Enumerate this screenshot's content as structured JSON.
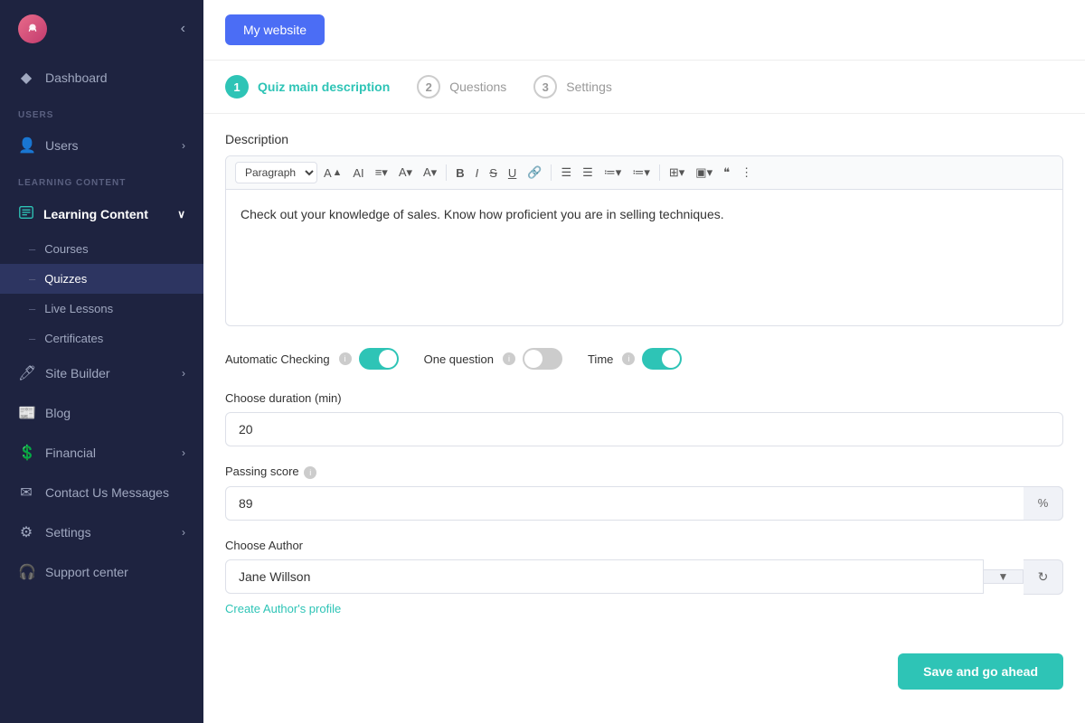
{
  "sidebar": {
    "logo": "🌸",
    "collapse_btn": "‹",
    "dashboard": {
      "label": "Dashboard",
      "icon": "◆"
    },
    "sections": {
      "users": {
        "label": "USERS",
        "items": [
          {
            "id": "users",
            "label": "Users",
            "icon": "👤",
            "arrow": "›"
          }
        ]
      },
      "learning_content": {
        "label": "LEARNING CONTENT",
        "main_label": "Learning Content",
        "icon": "📋",
        "arrow": "∨",
        "sub_items": [
          {
            "id": "courses",
            "label": "Courses"
          },
          {
            "id": "quizzes",
            "label": "Quizzes",
            "active": true
          },
          {
            "id": "live-lessons",
            "label": "Live Lessons"
          },
          {
            "id": "certificates",
            "label": "Certificates"
          }
        ]
      }
    },
    "bottom_items": [
      {
        "id": "site-builder",
        "label": "Site Builder",
        "icon": "🖊",
        "arrow": "›"
      },
      {
        "id": "blog",
        "label": "Blog",
        "icon": "📰"
      },
      {
        "id": "financial",
        "label": "Financial",
        "icon": "💲",
        "arrow": "›"
      },
      {
        "id": "contact-us",
        "label": "Contact Us Messages",
        "icon": "✉"
      },
      {
        "id": "settings",
        "label": "Settings",
        "icon": "⚙",
        "arrow": "›"
      },
      {
        "id": "support",
        "label": "Support center",
        "icon": "🎧"
      }
    ]
  },
  "topbar": {
    "my_website_btn": "My website"
  },
  "steps": [
    {
      "id": "step1",
      "number": "1",
      "label": "Quiz main description",
      "active": true
    },
    {
      "id": "step2",
      "number": "2",
      "label": "Questions",
      "active": false
    },
    {
      "id": "step3",
      "number": "3",
      "label": "Settings",
      "active": false
    }
  ],
  "form": {
    "description_label": "Description",
    "editor": {
      "paragraph_select": "Paragraph",
      "toolbar_buttons": [
        "Aᴬ",
        "AI",
        "≡",
        "A",
        "A",
        "B",
        "I",
        "S̶",
        "U̲",
        "🔗",
        "≡",
        "≡",
        "≔",
        "≔",
        "⊞",
        "⊡",
        "❝",
        "⋮"
      ],
      "content": "Check out your knowledge of sales. Know how proficient you are in selling techniques."
    },
    "toggles": [
      {
        "id": "automatic-checking",
        "label": "Automatic Checking",
        "info": true,
        "state": "on"
      },
      {
        "id": "one-question",
        "label": "One question",
        "info": true,
        "state": "off"
      },
      {
        "id": "time",
        "label": "Time",
        "info": true,
        "state": "on"
      }
    ],
    "duration": {
      "label": "Choose duration (min)",
      "value": "20",
      "placeholder": "20"
    },
    "passing_score": {
      "label": "Passing score",
      "info": true,
      "value": "89",
      "suffix": "%"
    },
    "choose_author": {
      "label": "Choose Author",
      "value": "Jane Willson",
      "create_link": "Create Author's profile"
    },
    "save_btn": "Save and go ahead"
  }
}
